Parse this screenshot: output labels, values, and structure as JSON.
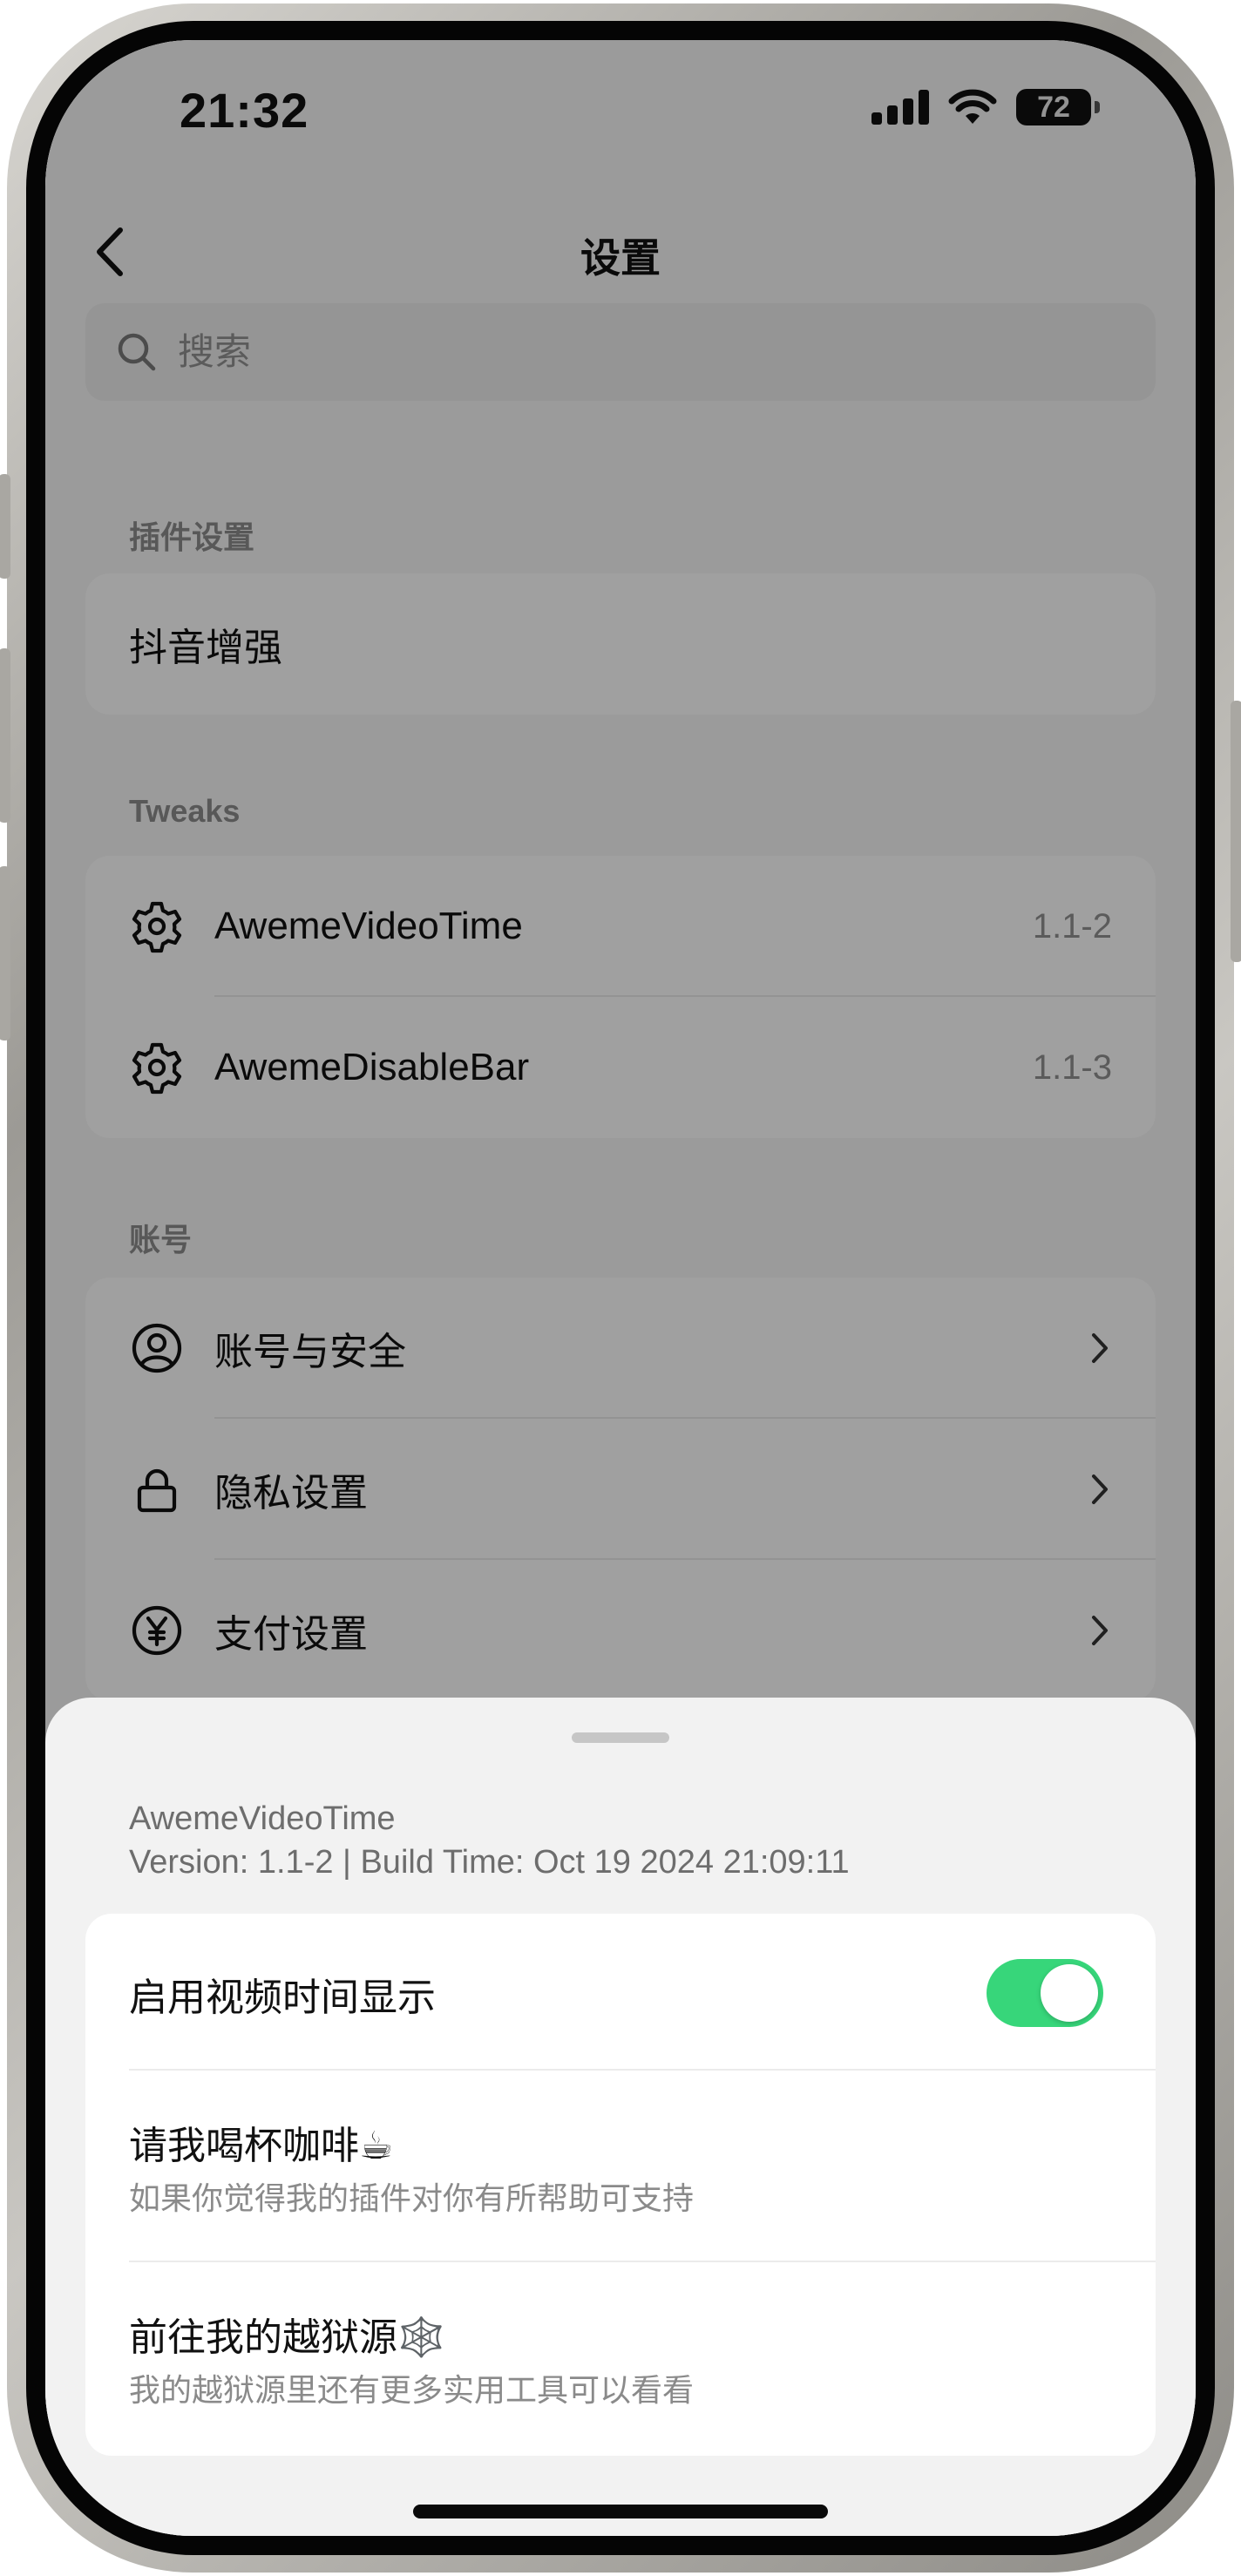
{
  "status_bar": {
    "time": "21:32",
    "battery": "72",
    "battery_fraction": 0.72
  },
  "nav": {
    "title": "设置"
  },
  "search": {
    "placeholder": "搜索"
  },
  "sections": {
    "plugin": {
      "label": "插件设置",
      "items": [
        {
          "label": "抖音增强"
        }
      ]
    },
    "tweaks": {
      "label": "Tweaks",
      "items": [
        {
          "label": "AwemeVideoTime",
          "value": "1.1-2",
          "icon": "gear-icon"
        },
        {
          "label": "AwemeDisableBar",
          "value": "1.1-3",
          "icon": "gear-icon"
        }
      ]
    },
    "account": {
      "label": "账号",
      "items": [
        {
          "label": "账号与安全",
          "icon": "user-circle-icon"
        },
        {
          "label": "隐私设置",
          "icon": "lock-icon"
        },
        {
          "label": "支付设置",
          "icon": "yen-icon"
        }
      ]
    }
  },
  "sheet": {
    "title": "AwemeVideoTime",
    "subtitle": "Version: 1.1-2 | Build Time: Oct 19 2024 21:09:11",
    "options": [
      {
        "title": "启用视频时间显示",
        "toggle_on": true
      },
      {
        "title": "请我喝杯咖啡☕",
        "desc": "如果你觉得我的插件对你有所帮助可支持"
      },
      {
        "title": "前往我的越狱源🕸️",
        "desc": "我的越狱源里还有更多实用工具可以看看"
      }
    ]
  },
  "colors": {
    "toggle_on": "#37d67a",
    "sheet_bg": "#f2f2f2",
    "dim_overlay": "rgba(0,0,0,0.36)"
  }
}
